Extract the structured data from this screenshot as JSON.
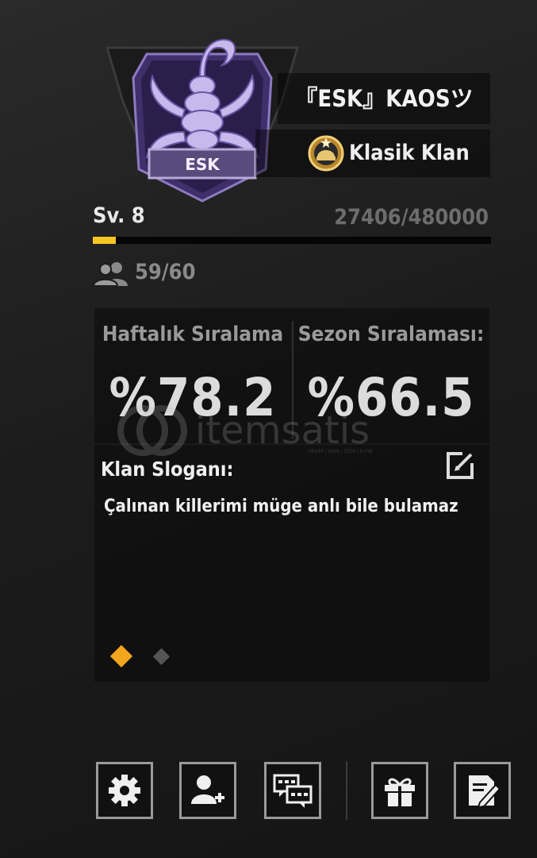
{
  "clan": {
    "emblem_tag": "ESK",
    "name": "『ESK』KAOSツ",
    "type": "Klasik Klan",
    "level_label": "Sv. 8",
    "xp": "27406/480000",
    "xp_progress": 0.057,
    "members": "59/60"
  },
  "stats": {
    "weekly_label": "Haftalık Sıralama",
    "weekly_value": "%78.2",
    "season_label": "Sezon Sıralaması:",
    "season_value": "%66.5"
  },
  "slogan": {
    "title": "Klan Sloganı:",
    "text": "Çalınan killerimi müge anlı bile bulamaz"
  },
  "pager": {
    "active_index": 0,
    "count": 2
  },
  "watermark": {
    "text": "itemsatis",
    "tagline": "HESAP / SKIN / ITEM / E-PIN"
  },
  "toolbar": {
    "icons": [
      "gear-icon",
      "add-user-icon",
      "chat-icon",
      "gift-icon",
      "edit-document-icon"
    ]
  },
  "colors": {
    "accent_yellow": "#f7c524",
    "pager_active": "#f3a51d",
    "emblem_purple": "#7b63b8"
  }
}
